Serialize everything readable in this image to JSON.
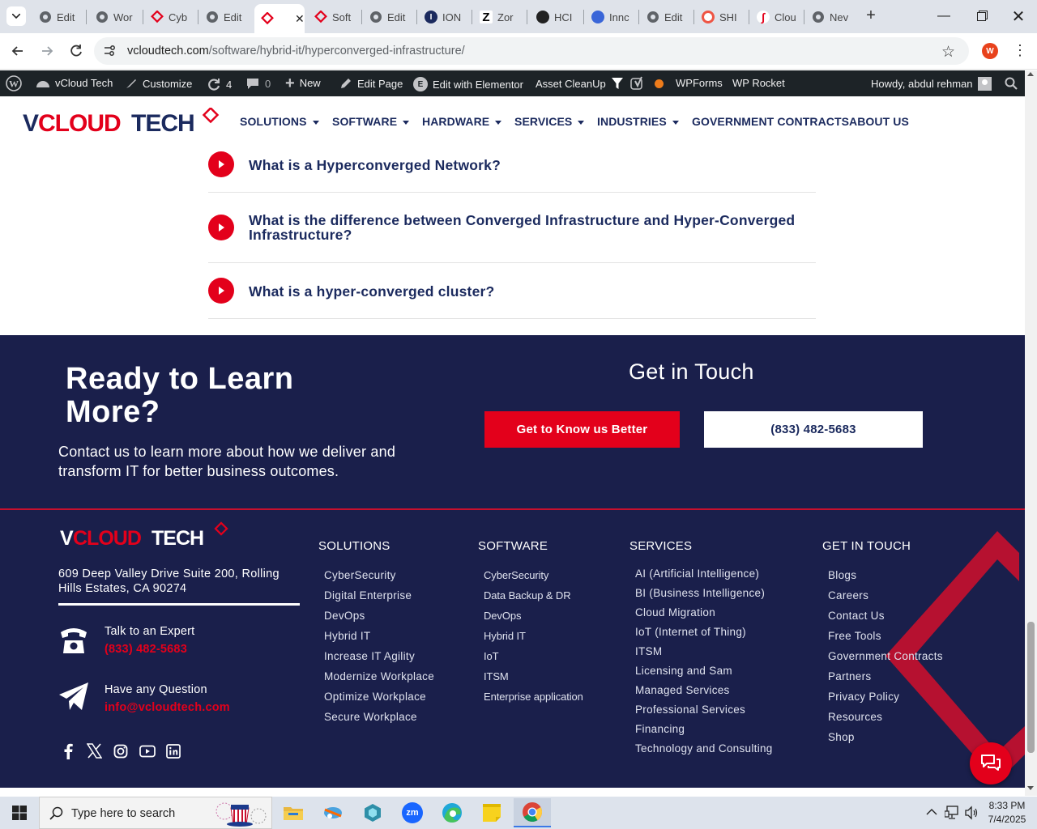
{
  "browser": {
    "tabs": [
      {
        "label": "Edit",
        "icon": "wordpress-icon",
        "active": false
      },
      {
        "label": "Wor",
        "icon": "wordpress-icon",
        "active": false
      },
      {
        "label": "Cyb",
        "icon": "vcloud-icon",
        "active": false
      },
      {
        "label": "Edit",
        "icon": "wordpress-icon",
        "active": false
      },
      {
        "label": "",
        "icon": "vcloud-icon",
        "active": true
      },
      {
        "label": "Soft",
        "icon": "vcloud-icon",
        "active": false
      },
      {
        "label": "Edit",
        "icon": "wordpress-icon",
        "active": false
      },
      {
        "label": "ION",
        "icon": "ion-icon",
        "active": false
      },
      {
        "label": "Zor",
        "icon": "zoro-icon",
        "active": false
      },
      {
        "label": "HCI",
        "icon": "openai-icon",
        "active": false
      },
      {
        "label": "Innc",
        "icon": "innovation-icon",
        "active": false
      },
      {
        "label": "Edit",
        "icon": "wordpress-icon",
        "active": false
      },
      {
        "label": "SHI",
        "icon": "shi-icon",
        "active": false
      },
      {
        "label": "Clou",
        "icon": "cloud-icon",
        "active": false
      },
      {
        "label": "Nev",
        "icon": "chrome-icon",
        "active": false
      }
    ],
    "url_host": "vcloudtech.com",
    "url_path": "/software/hybrid-it/hyperconverged-infrastructure/",
    "profile_initial": "W"
  },
  "wpbar": {
    "site_name": "vCloud Tech",
    "customize": "Customize",
    "updates_count": "4",
    "comments_count": "0",
    "new_label": "New",
    "edit_page": "Edit Page",
    "elementor": "Edit with Elementor",
    "asset_cleanup": "Asset CleanUp",
    "wpforms": "WPForms",
    "wp_rocket": "WP Rocket",
    "howdy": "Howdy, abdul rehman"
  },
  "header": {
    "logo_text": "VCLOUD TECH",
    "nav": [
      {
        "label": "SOLUTIONS",
        "dropdown": true
      },
      {
        "label": "SOFTWARE",
        "dropdown": true
      },
      {
        "label": "HARDWARE",
        "dropdown": true
      },
      {
        "label": "SERVICES",
        "dropdown": true
      },
      {
        "label": "INDUSTRIES",
        "dropdown": true
      },
      {
        "label": "GOVERNMENT CONTRACTS",
        "dropdown": false
      },
      {
        "label": "ABOUT US",
        "dropdown": false
      }
    ]
  },
  "faq": [
    {
      "question": "What is a Hyperconverged Network?"
    },
    {
      "question": "What is the difference between Converged Infrastructure and Hyper-Converged Infrastructure?"
    },
    {
      "question": "What is a hyper-converged cluster?"
    }
  ],
  "cta": {
    "title": "Ready to Learn More?",
    "text": "Contact us to learn more about how we deliver and transform IT for better business outcomes.",
    "get_in_touch": "Get in Touch",
    "button_primary": "Get to Know us Better",
    "button_phone": "(833) 482-5683"
  },
  "footer": {
    "logo_text": "VCLOUD TECH",
    "address": "609 Deep Valley Drive Suite 200, Rolling Hills Estates, CA 90274",
    "talk_label": "Talk to an Expert",
    "talk_phone": "(833) 482-5683",
    "question_label": "Have any Question",
    "email": "info@vcloudtech.com",
    "socials": [
      "facebook-icon",
      "x-icon",
      "instagram-icon",
      "youtube-icon",
      "linkedin-icon"
    ],
    "columns": [
      {
        "heading": "SOLUTIONS",
        "items": [
          "CyberSecurity",
          "Digital Enterprise",
          "DevOps",
          "Hybrid IT",
          "Increase IT Agility",
          "Modernize Workplace",
          "Optimize Workplace",
          "Secure Workplace"
        ]
      },
      {
        "heading": "SOFTWARE",
        "items": [
          "CyberSecurity",
          "Data Backup & DR",
          "DevOps",
          "Hybrid IT",
          "IoT",
          "ITSM",
          "Enterprise application"
        ]
      },
      {
        "heading": "SERVICES",
        "items": [
          "AI (Artificial Intelligence)",
          "BI (Business Intelligence)",
          "Cloud Migration",
          "IoT (Internet of Thing)",
          "ITSM",
          "Licensing and Sam",
          "Managed Services",
          "Professional Services",
          "Financing",
          "Technology and Consulting"
        ]
      },
      {
        "heading": "GET IN TOUCH",
        "items": [
          "Blogs",
          "Careers",
          "Contact Us",
          "Free Tools",
          "Government Contracts",
          "Partners",
          "Privacy Policy",
          "Resources",
          "Shop"
        ]
      }
    ]
  },
  "taskbar": {
    "search_placeholder": "Type here to search",
    "time": "8:33 PM",
    "date": "7/4/2025"
  },
  "colors": {
    "brand_red": "#e3001b",
    "navy": "#1a1f4b",
    "heading_blue": "#1b2a5e"
  }
}
